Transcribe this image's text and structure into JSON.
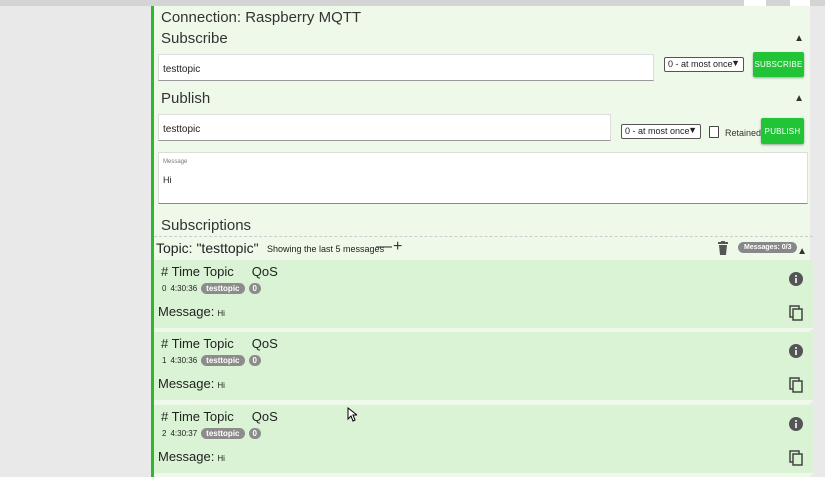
{
  "connection": {
    "title": "Connection: Raspberry MQTT"
  },
  "subscribe": {
    "title": "Subscribe",
    "topic_value": "testtopic",
    "qos_value": "0 - at most once",
    "button_label": "SUBSCRIBE"
  },
  "publish": {
    "title": "Publish",
    "topic_value": "testtopic",
    "qos_value": "0 - at most once",
    "retained_label": "Retained",
    "button_label": "PUBLISH",
    "message_label": "Message",
    "message_value": "Hi"
  },
  "subscriptions": {
    "title": "Subscriptions",
    "topic_label": "Topic: \"testtopic\"",
    "showing_text": "Showing the last 5 messages",
    "minus": "—",
    "plus": "+",
    "messages_badge": "Messages: 0/3",
    "messages": [
      {
        "header": "# Time Topic     QoS",
        "index": "0",
        "time": "4:30:36",
        "topic": "testtopic",
        "qos": "0",
        "message_label": "Message:",
        "message": "Hi"
      },
      {
        "header": "# Time Topic     QoS",
        "index": "1",
        "time": "4:30:36",
        "topic": "testtopic",
        "qos": "0",
        "message_label": "Message:",
        "message": "Hi"
      },
      {
        "header": "# Time Topic     QoS",
        "index": "2",
        "time": "4:30:37",
        "topic": "testtopic",
        "qos": "0",
        "message_label": "Message:",
        "message": "Hi"
      }
    ]
  },
  "colors": {
    "accent": "#21c437",
    "panel_bg": "#eef9ea",
    "card_bg": "#d9f3d4",
    "badge": "#8c8c8c"
  },
  "icons": [
    "chevron-up-icon",
    "trash-icon",
    "info-icon",
    "copy-icon",
    "cursor-icon"
  ]
}
